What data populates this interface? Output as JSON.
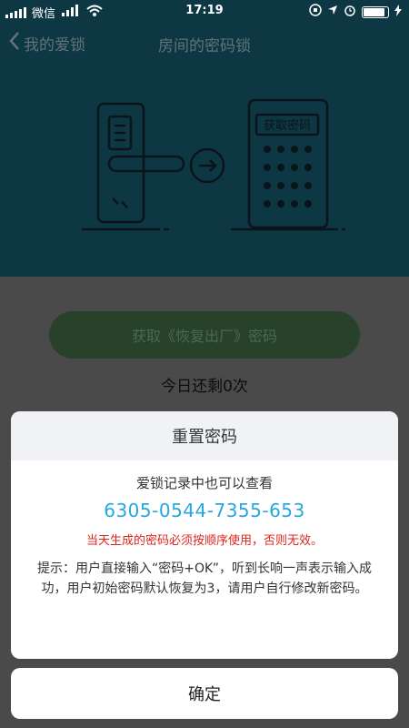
{
  "status": {
    "carrier": "微信",
    "time": "17:19"
  },
  "nav": {
    "back_label": "我的爱锁",
    "title": "房间的密码锁"
  },
  "hero": {
    "keypad_label": "获取密码"
  },
  "main": {
    "button_label": "获取《恢复出厂》密码",
    "remaining_text": "今日还剩0次"
  },
  "dialog": {
    "title": "重置密码",
    "subtitle": "爱锁记录中也可以查看",
    "code": "6305-0544-7355-653",
    "warning": "当天生成的密码必须按顺序使用，否则无效。",
    "tip": "提示：用户直接输入“密码+OK”，听到长响一声表示输入成功，用户初始密码默认恢复为3，请用户自行修改新密码。"
  },
  "confirm_label": "确定",
  "colors": {
    "header_bg": "#0d3742",
    "accent_code": "#27a6e0",
    "warning": "#e0241e"
  }
}
